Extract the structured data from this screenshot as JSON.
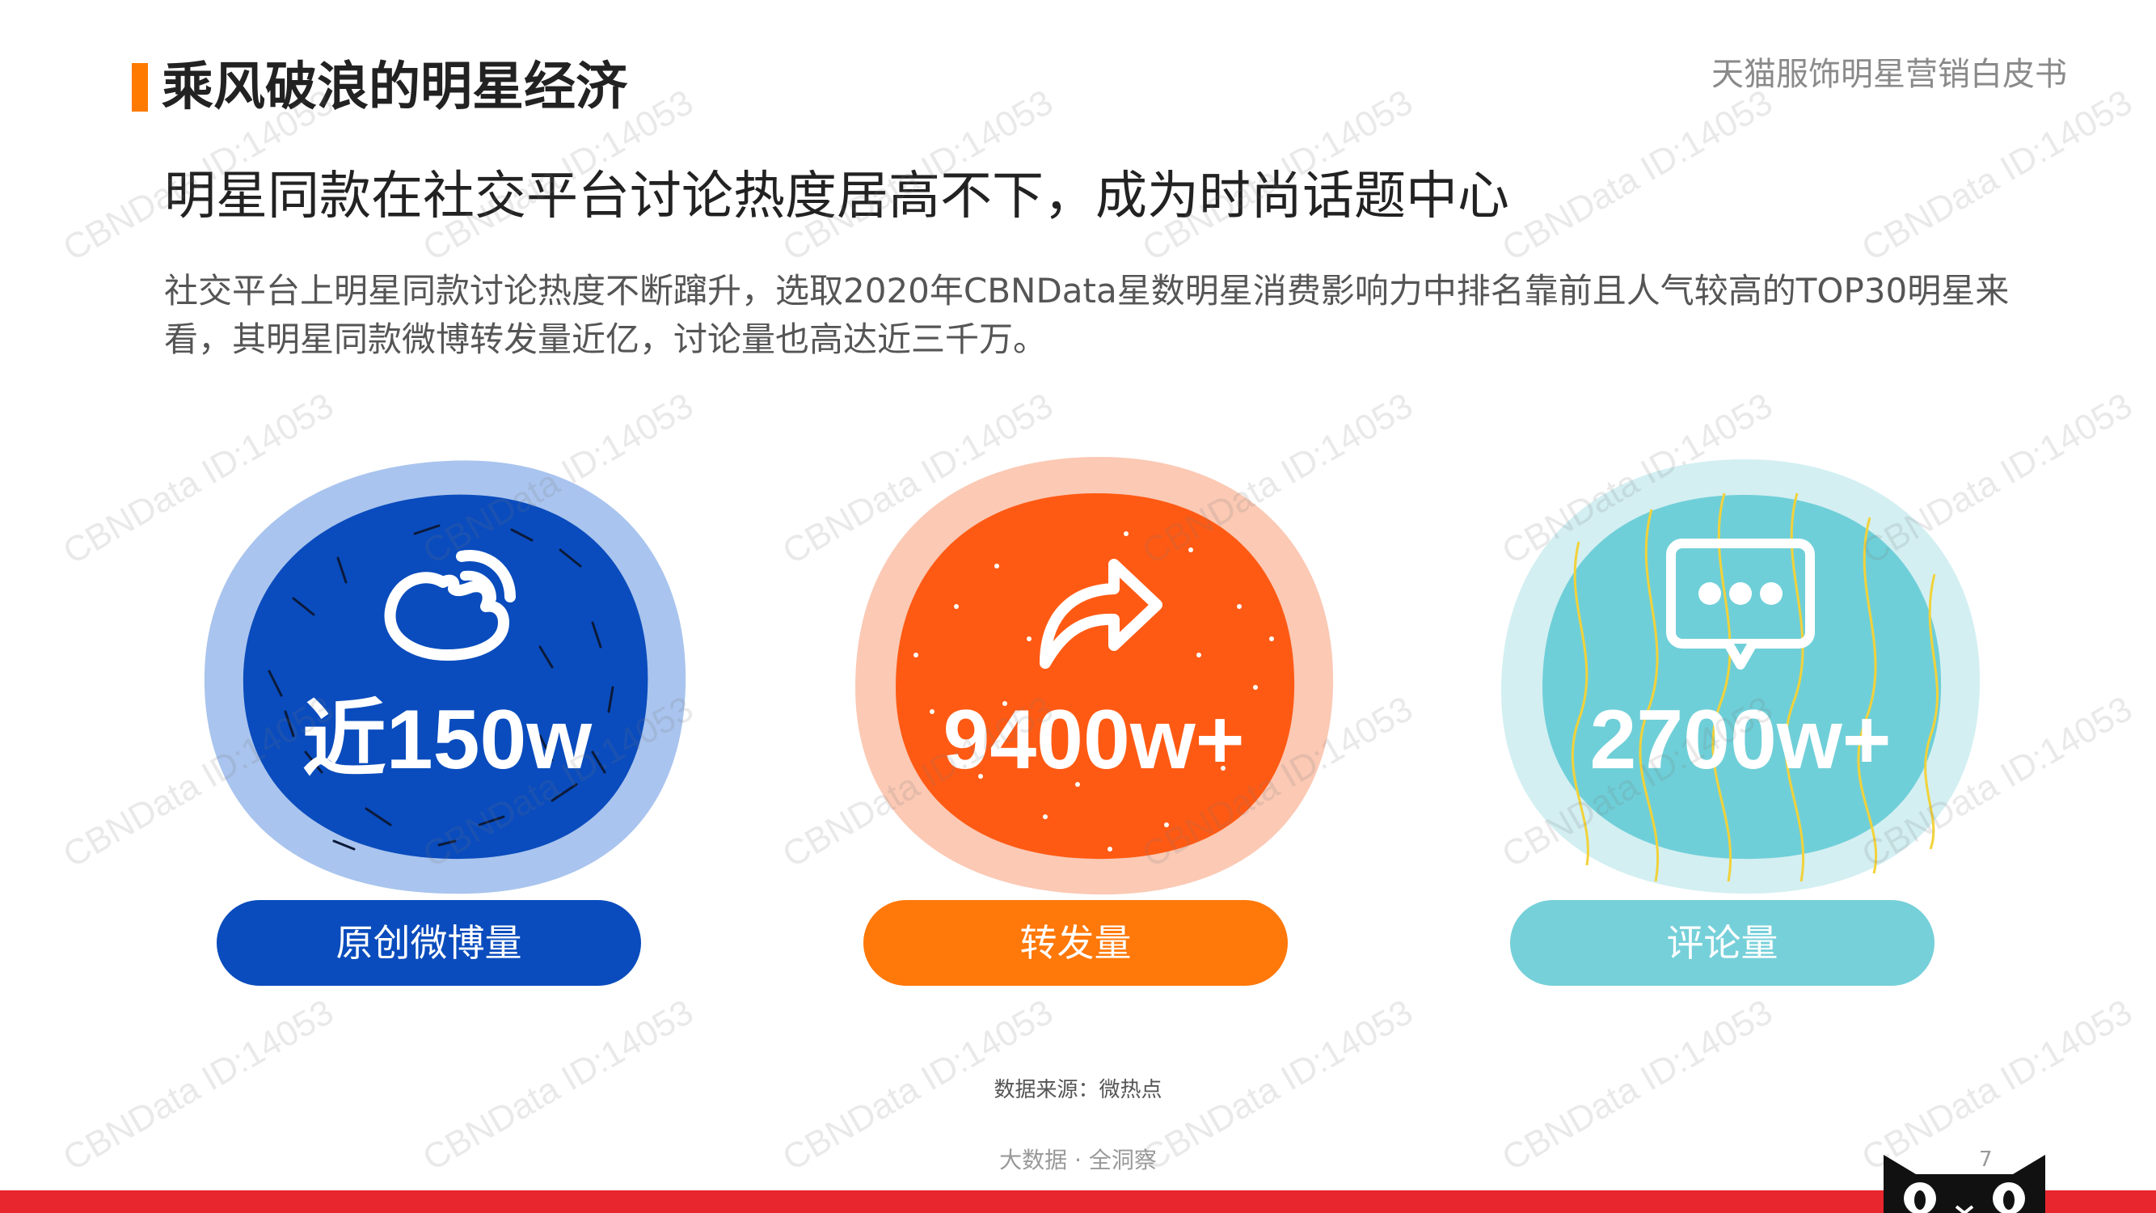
{
  "header": {
    "section_title": "乘风破浪的明星经济",
    "report_name": "天猫服饰明星营销白皮书"
  },
  "headline": "明星同款在社交平台讨论热度居高不下，成为时尚话题中心",
  "description": "社交平台上明星同款讨论热度不断蹿升，选取2020年CBNData星数明星消费影响力中排名靠前且人气较高的TOP30明星来看，其明星同款微博转发量近亿，讨论量也高达近三千万。",
  "stats": [
    {
      "value": "近150w",
      "label": "原创微博量",
      "icon": "weibo-icon",
      "color": "#0a4cbd",
      "halo": "#a9c4ee",
      "pill": "#0a4cbd"
    },
    {
      "value": "9400w+",
      "label": "转发量",
      "icon": "share-arrow-icon",
      "color": "#ff5a14",
      "halo": "#fbc9b4",
      "pill": "#ff780a"
    },
    {
      "value": "2700w+",
      "label": "评论量",
      "icon": "comment-bubble-icon",
      "color": "#6fcfd8",
      "halo": "#d3eff2",
      "pill": "#76d0d9"
    }
  ],
  "footer": {
    "source": "数据来源：微热点",
    "tagline": "大数据 · 全洞察",
    "page_number": "7"
  },
  "watermark_text": "CBNData ID:14053",
  "colors": {
    "accent": "#ff7a00",
    "bottom_bar": "#e8262d"
  }
}
